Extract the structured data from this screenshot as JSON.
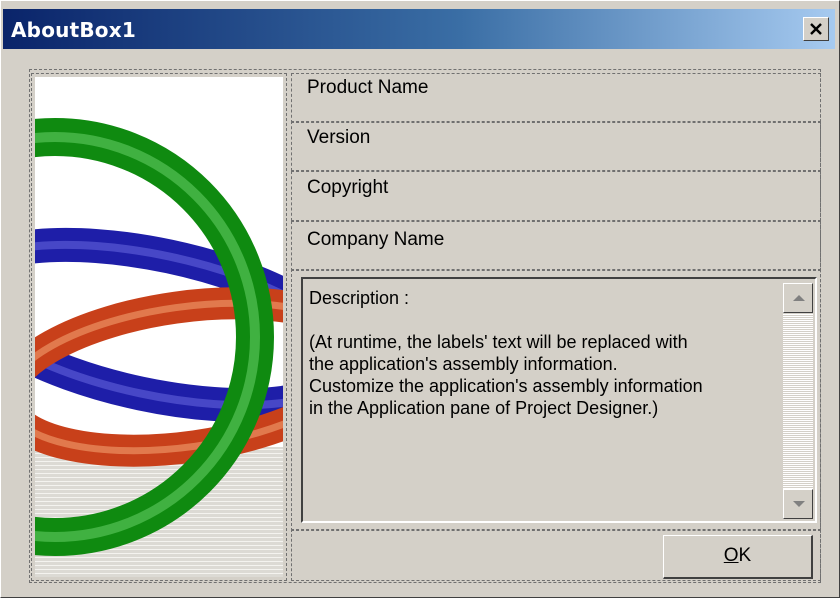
{
  "window": {
    "title": "AboutBox1",
    "close_glyph": "✕"
  },
  "labels": {
    "product_name": "Product Name",
    "version": "Version",
    "copyright": "Copyright",
    "company_name": "Company Name"
  },
  "description": {
    "text": "Description :\n\n(At runtime, the labels' text will be replaced with\nthe application's assembly information.\nCustomize the application's assembly information\nin the Application pane of Project Designer.)"
  },
  "ok_button": {
    "mnemonic": "O",
    "rest": "K"
  },
  "icons": {
    "logo": "interlocking-rings-logo",
    "close": "close-icon",
    "scroll_up": "scroll-up-arrow-icon",
    "scroll_down": "scroll-down-arrow-icon"
  },
  "colors": {
    "face": "#d4d0c8",
    "title_start": "#0a246a",
    "title_end": "#a6caf0",
    "ring_green": "#1a9a1a",
    "ring_red": "#d04a1a",
    "ring_blue": "#2a2ab8"
  }
}
